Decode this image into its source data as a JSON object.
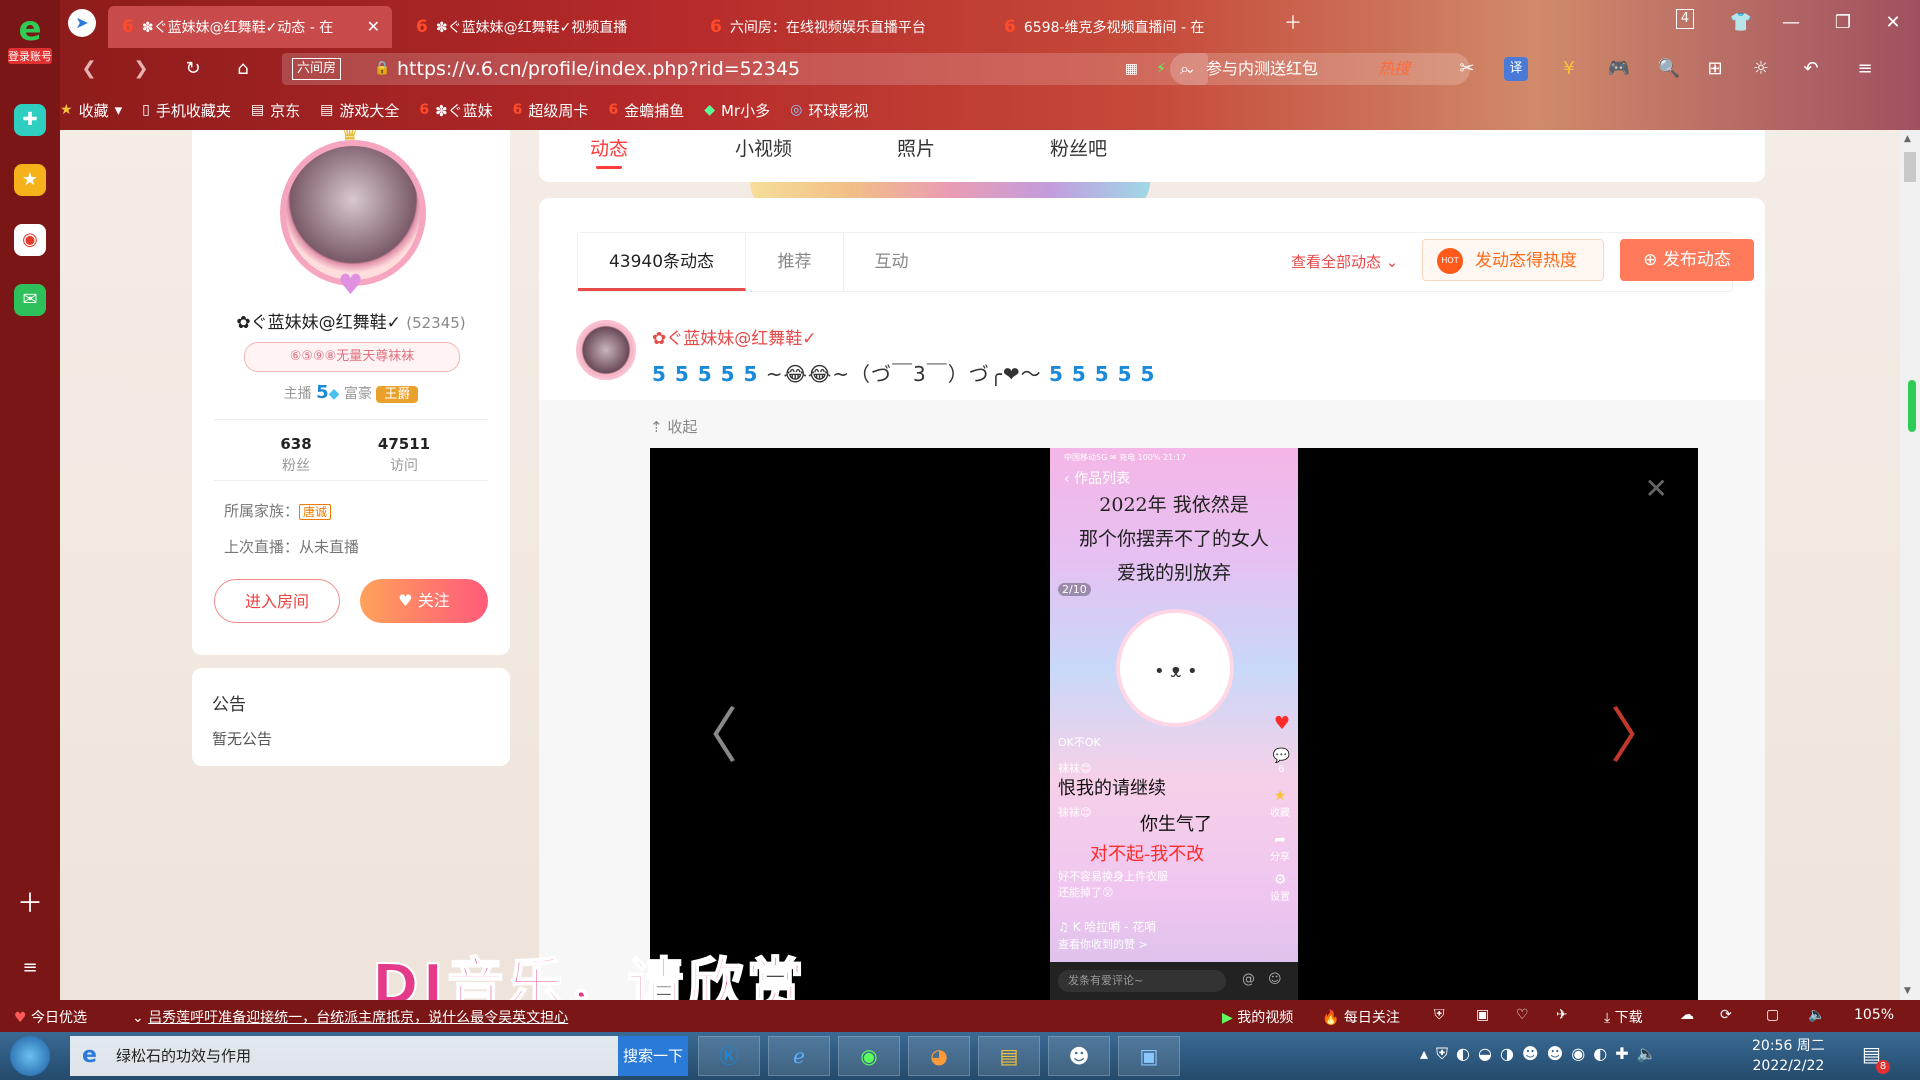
{
  "browser": {
    "account_label": "登录账号",
    "tabs": [
      {
        "title": "✽ぐ蓝妹妹@红舞鞋✓动态 - 在",
        "active": true
      },
      {
        "title": "✽ぐ蓝妹妹@红舞鞋✓视频直播",
        "active": false
      },
      {
        "title": "六间房：在线视频娱乐直播平台",
        "active": false
      },
      {
        "title": "6598-维克多视频直播间 - 在",
        "active": false
      }
    ],
    "tab_count": "4",
    "url_site_tag": "六间房",
    "url": "https://v.6.cn/profile/index.php?rid=52345",
    "search_placeholder": "参与内测送红包",
    "search_hot": "热搜",
    "translate_label": "译",
    "bookmarks": [
      "收藏",
      "手机收藏夹",
      "京东",
      "游戏大全",
      "✽ぐ蓝妹",
      "超级周卡",
      "金蟾捕鱼",
      "Mr小多",
      "环球影视"
    ]
  },
  "profile": {
    "name": "✿ぐ蓝妹妹@红舞鞋✓",
    "rid": "(52345)",
    "badge": "⑥⑤⑨⑧无量天尊袜袜",
    "anchor_label": "主播",
    "anchor_level": "5",
    "rich_label": "富豪",
    "rich_title": "王爵",
    "fans_count": "638",
    "fans_label": "粉丝",
    "visits_count": "47511",
    "visits_label": "访问",
    "family_label": "所属家族：",
    "family_name": "唐诚",
    "last_live": "上次直播：从未直播",
    "enter_room": "进入房间",
    "follow": "关注"
  },
  "notice": {
    "title": "公告",
    "content": "暂无公告"
  },
  "top_tabs": [
    "动态",
    "小视频",
    "照片",
    "粉丝吧"
  ],
  "feed": {
    "tabs": [
      "43940条动态",
      "推荐",
      "互动"
    ],
    "view_all": "查看全部动态",
    "hot_button": "发动态得热度",
    "hot_icon_text": "HOT",
    "publish_button": "发布动态",
    "post": {
      "author": "✿ぐ蓝妹妹@红舞鞋✓",
      "text_prefix": "5 5 5 5 5",
      "text_middle": "~😂😂~（づ￣3￣）づ╭❤～",
      "text_suffix": "5 5 5 5 5",
      "collapse": "收起"
    }
  },
  "video": {
    "statusline": "中国移动5G  ✉  充电 100% 21:17",
    "header": "作品列表",
    "line1": "2022年 我依然是",
    "line2": "那个你摆弄不了的女人",
    "line3": "爱我的别放弃",
    "counter": "2/10",
    "okbtn": "OK不OK",
    "comment1": "袜袜😊",
    "overlay1": "恨我的请继续",
    "comment2": "袜袜😊",
    "overlay2": "你生气了",
    "overlay3": "对不起-我不改",
    "desc": "好不容易换身上件衣服",
    "desc2": "还能掉了😲",
    "music": "K 哈拉哨 - 花哨",
    "received": "查看你收到的赞 >",
    "comment_placeholder": "发条有爱评论~",
    "side_labels": [
      "6",
      "收藏",
      "分享",
      "设置"
    ]
  },
  "caption": "DJ音乐，请欣赏",
  "statusbar": {
    "today": "今日优选",
    "news": "吕秀莲呼吁准备迎接统一，台统派主席抵京，说什么最令吴英文担心",
    "my_video": "我的视频",
    "daily_follow": "每日关注",
    "download": "下载",
    "zoom": "105%"
  },
  "taskbar": {
    "ie_task": "绿松石的功效与作用",
    "search_button": "搜索一下",
    "time": "20:56 周二",
    "date": "2022/2/22",
    "notify_count": "8"
  }
}
